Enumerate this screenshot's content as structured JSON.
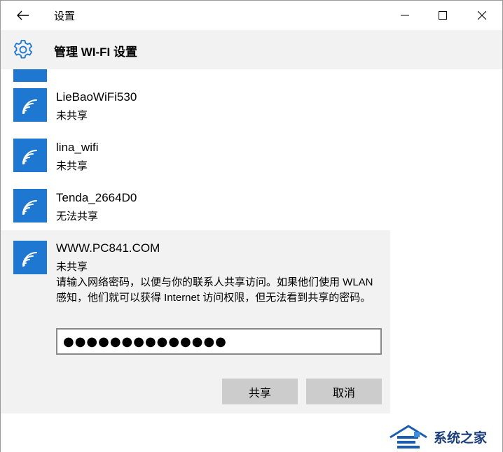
{
  "window": {
    "app_title": "设置",
    "page_title": "管理 WI-FI 设置"
  },
  "networks": [
    {
      "ssid": "LieBaoWiFi530",
      "status": "未共享"
    },
    {
      "ssid": "lina_wifi",
      "status": "未共享"
    },
    {
      "ssid": "Tenda_2664D0",
      "status": "无法共享"
    }
  ],
  "selected_network": {
    "ssid": "WWW.PC841.COM",
    "status": "未共享",
    "description": "请输入网络密码，以便与你的联系人共享访问。如果他们使用 WLAN 感知，他们就可以获得 Internet 访问权限，但无法看到共享的密码。",
    "password_value": "●●●●●●●●●●●●●●",
    "share_label": "共享",
    "cancel_label": "取消"
  },
  "watermark": {
    "text": "系统之家"
  },
  "icons": {
    "back": "back-arrow-icon",
    "minimize": "minimize-icon",
    "maximize": "maximize-icon",
    "close": "close-icon",
    "settings": "gear-icon",
    "network": "wifi-icon"
  },
  "colors": {
    "accent": "#1e78d2",
    "header_bg": "#f2f2f2",
    "selected_bg": "#f2f2f2",
    "button_bg": "#cccccc"
  }
}
